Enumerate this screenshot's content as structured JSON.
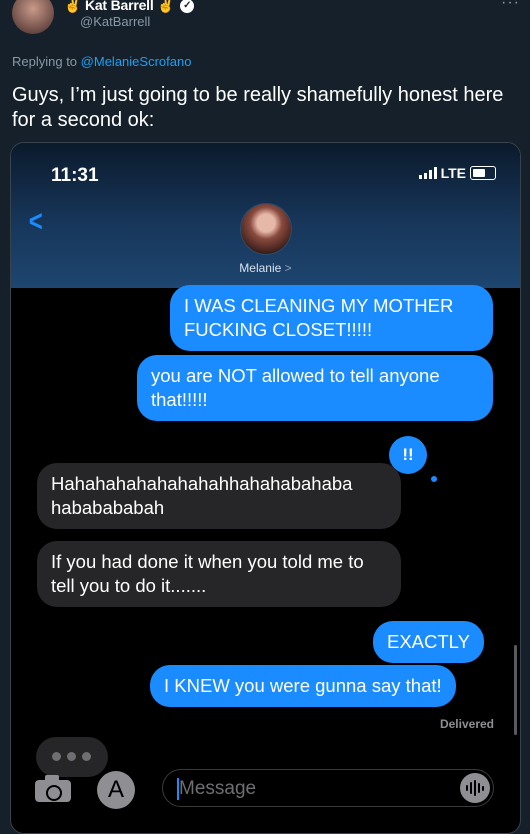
{
  "tweet": {
    "display_name": "Kat Barrell",
    "handle": "@KatBarrell",
    "replying_prefix": "Replying to",
    "replying_to": "@MelanieScrofano",
    "text": "Guys, I’m just going to be really shamefully honest here for a second ok:",
    "more_label": "···"
  },
  "phone": {
    "time": "11:31",
    "network": "LTE",
    "contact_name": "Melanie",
    "contact_chevron": ">",
    "back_label": "<",
    "reaction": "!!",
    "delivered_label": "Delivered",
    "compose_placeholder": "Message",
    "appstore_glyph": "A"
  },
  "messages": [
    {
      "side": "out",
      "text": "I WAS CLEANING MY MOTHER FUCKING CLOSET!!!!!"
    },
    {
      "side": "out",
      "text": "you are NOT allowed to tell anyone that!!!!!"
    },
    {
      "side": "in",
      "text": "Hahahahahahahahahhahahabahaba hababababah"
    },
    {
      "side": "in",
      "text": "If you had done it when you told me to tell you to do it......."
    },
    {
      "side": "out",
      "text": "EXACTLY"
    },
    {
      "side": "out",
      "text": "I KNEW you were gunna say that!"
    }
  ],
  "colors": {
    "page_bg": "#15202b",
    "link": "#1da1f2",
    "imessage_blue": "#1a8cff",
    "incoming_bubble": "#262628"
  },
  "icons": [
    "hand-emoji-icon",
    "verified-badge-icon",
    "more-icon",
    "back-chevron-icon",
    "signal-bars-icon",
    "battery-icon",
    "camera-icon",
    "appstore-icon",
    "audio-waveform-icon"
  ]
}
